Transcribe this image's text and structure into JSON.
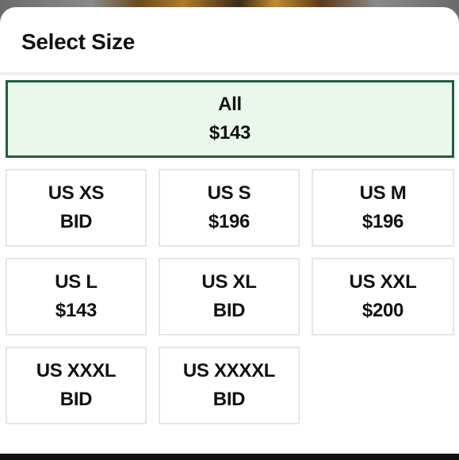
{
  "sheet": {
    "title": "Select Size"
  },
  "sizes": {
    "all": {
      "label": "All",
      "price": "$143",
      "selected": true
    },
    "xs": {
      "label": "US XS",
      "price": "BID"
    },
    "s": {
      "label": "US S",
      "price": "$196"
    },
    "m": {
      "label": "US M",
      "price": "$196"
    },
    "l": {
      "label": "US L",
      "price": "$143"
    },
    "xl": {
      "label": "US XL",
      "price": "BID"
    },
    "xxl": {
      "label": "US XXL",
      "price": "$200"
    },
    "xxxl": {
      "label": "US XXXL",
      "price": "BID"
    },
    "xxxxl": {
      "label": "US XXXXL",
      "price": "BID"
    }
  },
  "colors": {
    "selected_border": "#1e5e3e",
    "selected_fill": "#eaf8ec"
  }
}
